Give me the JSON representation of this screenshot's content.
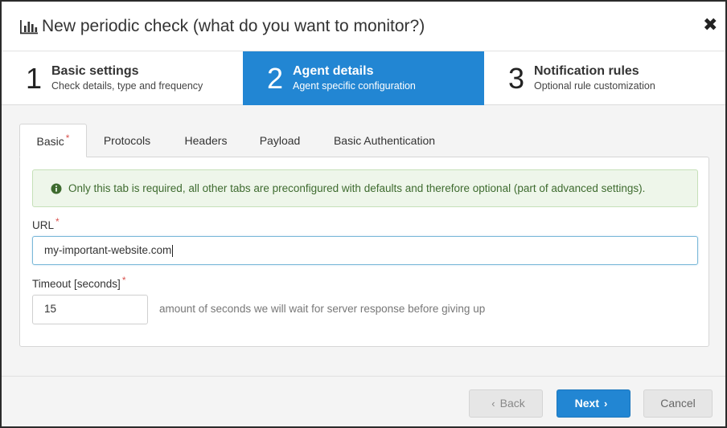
{
  "header": {
    "title": "New periodic check (what do you want to monitor?)",
    "icon": "bar-chart-icon",
    "close_glyph": "✖"
  },
  "steps": [
    {
      "number": "1",
      "title": "Basic settings",
      "subtitle": "Check details, type and frequency",
      "active": false
    },
    {
      "number": "2",
      "title": "Agent details",
      "subtitle": "Agent specific configuration",
      "active": true
    },
    {
      "number": "3",
      "title": "Notification rules",
      "subtitle": "Optional rule customization",
      "active": false
    }
  ],
  "tabs": [
    {
      "label": "Basic",
      "required": "*",
      "active": true
    },
    {
      "label": "Protocols"
    },
    {
      "label": "Headers"
    },
    {
      "label": "Payload"
    },
    {
      "label": "Basic Authentication"
    }
  ],
  "alert": {
    "icon": "info-circle-icon",
    "text": "Only this tab is required, all other tabs are preconfigured with defaults and therefore optional (part of advanced settings)."
  },
  "form": {
    "url": {
      "label": "URL",
      "required": "*",
      "value": "my-important-website.com"
    },
    "timeout": {
      "label": "Timeout [seconds]",
      "required": "*",
      "value": "15",
      "help": "amount of seconds we will wait for server response before giving up"
    }
  },
  "footer": {
    "back_label": "Back",
    "next_label": "Next",
    "cancel_label": "Cancel",
    "back_chevron": "‹",
    "next_chevron": "›"
  },
  "colors": {
    "accent": "#2286d3",
    "required": "#d9534f",
    "alert_bg": "#eef6ea",
    "alert_text": "#3e6b2f"
  }
}
